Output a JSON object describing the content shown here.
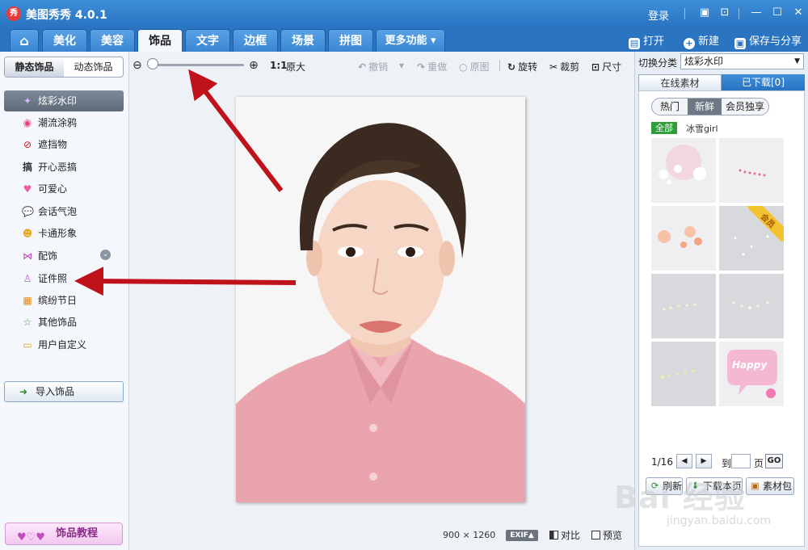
{
  "window": {
    "title": "美图秀秀 4.0.1",
    "logo_text": "秀",
    "login": "登录",
    "controls": [
      "feedback-icon",
      "skin-icon",
      "minimize-icon",
      "maximize-icon",
      "close-icon"
    ]
  },
  "nav": {
    "tabs": [
      {
        "label": "",
        "icon": "home-icon"
      },
      {
        "label": "美化"
      },
      {
        "label": "美容"
      },
      {
        "label": "饰品",
        "active": true
      },
      {
        "label": "文字"
      },
      {
        "label": "边框"
      },
      {
        "label": "场景"
      },
      {
        "label": "拼图"
      },
      {
        "label": "更多功能 ▾"
      }
    ],
    "actions": {
      "open": "打开",
      "new": "新建",
      "save": "保存与分享"
    }
  },
  "left": {
    "segment": {
      "static": "静态饰品",
      "dynamic": "动态饰品",
      "selected": "static"
    },
    "categories": [
      {
        "label": "炫彩水印",
        "icon": "sparkle-icon",
        "active": true
      },
      {
        "label": "潮流涂鸦",
        "icon": "lips-icon"
      },
      {
        "label": "遮挡物",
        "icon": "block-icon"
      },
      {
        "label": "开心恶搞",
        "icon": "prank-icon"
      },
      {
        "label": "可爱心",
        "icon": "heart-icon"
      },
      {
        "label": "会话气泡",
        "icon": "speech-bubble-icon"
      },
      {
        "label": "卡通形象",
        "icon": "cartoon-icon"
      },
      {
        "label": "配饰",
        "icon": "bow-icon"
      },
      {
        "label": "证件照",
        "icon": "shirt-icon"
      },
      {
        "label": "缤纷节日",
        "icon": "gift-icon"
      },
      {
        "label": "其他饰品",
        "icon": "star-icon"
      },
      {
        "label": "用户自定义",
        "icon": "folder-icon"
      }
    ],
    "import_button": "导入饰品",
    "tutorial_button": "饰品教程"
  },
  "toolbar": {
    "ratio": "1:1",
    "fit": "原大",
    "undo": "撤销",
    "redo": "重做",
    "original": "原图",
    "rotate": "旋转",
    "crop": "裁剪",
    "resize": "尺寸"
  },
  "canvas": {
    "width": "900",
    "height": "1260",
    "exif": "EXIF▲",
    "compare": "对比",
    "preview": "预览"
  },
  "right": {
    "switch_label": "切换分类",
    "switch_value": "炫彩水印",
    "tabs": {
      "online": "在线素材",
      "downloaded": "已下载[0]"
    },
    "filters": [
      "热门",
      "新鲜",
      "会员独享"
    ],
    "active_filter": "新鲜",
    "all_badge": "全部",
    "tag": "冰雪girl",
    "vip_label": "会员",
    "happy_text": "Happy",
    "page": "1/16",
    "goto_label": "到",
    "page_label": "页",
    "go": "GO",
    "actions": {
      "refresh": "刷新",
      "download": "下载本页",
      "pack": "素材包"
    }
  },
  "watermark": {
    "brand": "Bai  经验",
    "url": "jingyan.baidu.com"
  },
  "colors": {
    "titlebar": "#2a74c2",
    "accent_arrow": "#c0121a",
    "active_category": "#6a7482"
  }
}
